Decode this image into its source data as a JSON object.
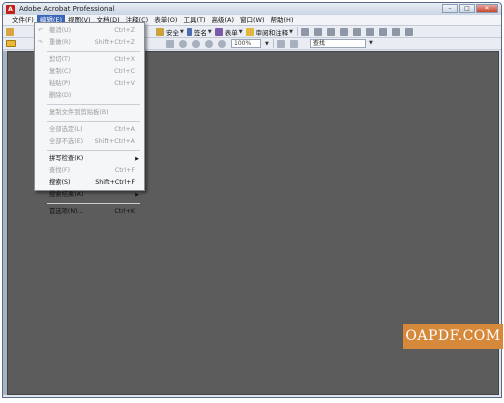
{
  "window": {
    "title": "Adobe Acrobat Professional",
    "app_icon": "A"
  },
  "menubar": {
    "items": [
      "文件(F)",
      "编辑(E)",
      "视图(V)",
      "文档(D)",
      "注释(C)",
      "表单(O)",
      "工具(T)",
      "高级(A)",
      "窗口(W)",
      "帮助(H)"
    ],
    "active_index": 1
  },
  "toolbar": {
    "security_label": "安全",
    "sign_label": "签名",
    "forms_label": "表单",
    "review_label": "审阅和注释",
    "zoom_value": "100%",
    "find_placeholder": "查找"
  },
  "edit_menu": {
    "items": [
      {
        "label": "撤消(U)",
        "shortcut": "Ctrl+Z",
        "disabled": true,
        "icon": "undo-icon"
      },
      {
        "label": "重做(R)",
        "shortcut": "Shift+Ctrl+Z",
        "disabled": true,
        "icon": "redo-icon"
      },
      {
        "separator": true
      },
      {
        "label": "剪切(T)",
        "shortcut": "Ctrl+X",
        "disabled": true
      },
      {
        "label": "复制(C)",
        "shortcut": "Ctrl+C",
        "disabled": true
      },
      {
        "label": "粘贴(P)",
        "shortcut": "Ctrl+V",
        "disabled": true
      },
      {
        "label": "删除(D)",
        "shortcut": "",
        "disabled": true
      },
      {
        "separator": true
      },
      {
        "label": "复制文件到剪贴板(B)",
        "shortcut": "",
        "disabled": true
      },
      {
        "separator": true
      },
      {
        "label": "全部选定(L)",
        "shortcut": "Ctrl+A",
        "disabled": true
      },
      {
        "label": "全部不选(E)",
        "shortcut": "Shift+Ctrl+A",
        "disabled": true
      },
      {
        "separator": true
      },
      {
        "label": "拼写检查(K)",
        "shortcut": "",
        "disabled": false,
        "submenu": true
      },
      {
        "label": "查找(F)",
        "shortcut": "Ctrl+F",
        "disabled": true
      },
      {
        "label": "搜索(S)",
        "shortcut": "Shift+Ctrl+F",
        "disabled": false
      },
      {
        "label": "搜索结果(A)",
        "shortcut": "",
        "disabled": false,
        "submenu": true
      },
      {
        "separator": true
      },
      {
        "label": "首选项(N)...",
        "shortcut": "Ctrl+K",
        "disabled": false
      }
    ]
  },
  "watermark": {
    "text": "OAPDF.COM"
  },
  "colors": {
    "workspace": "#5c5c5c",
    "menu_highlight": "#3a66b8",
    "watermark_bg": "#d6893a"
  }
}
